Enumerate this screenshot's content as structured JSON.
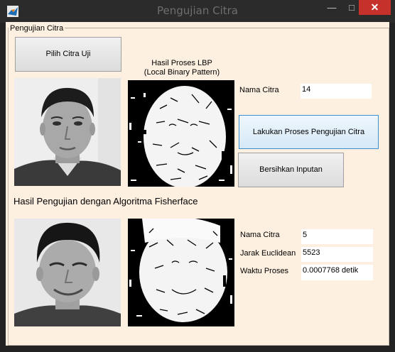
{
  "window": {
    "title": "Pengujian Citra"
  },
  "panel": {
    "title": "Pengujian Citra"
  },
  "buttons": {
    "pick": "Pilih Citra Uji",
    "process": "Lakukan Proses Pengujian Citra",
    "clear": "Bersihkan Inputan"
  },
  "lbp": {
    "line1": "Hasil Proses LBP",
    "line2": "(Local Binary Pattern)"
  },
  "input": {
    "name_label": "Nama Citra",
    "name_value": "14"
  },
  "result": {
    "heading": "Hasil Pengujian dengan Algoritma Fisherface",
    "name_label": "Nama Citra",
    "name_value": "5",
    "dist_label": "Jarak Euclidean",
    "dist_value": "5523",
    "time_label": "Waktu Proses",
    "time_value": "0.0007768 detik"
  },
  "icons": {
    "app": "matlab-icon",
    "minimize": "minimize-icon",
    "maximize": "maximize-icon",
    "close": "close-icon"
  }
}
